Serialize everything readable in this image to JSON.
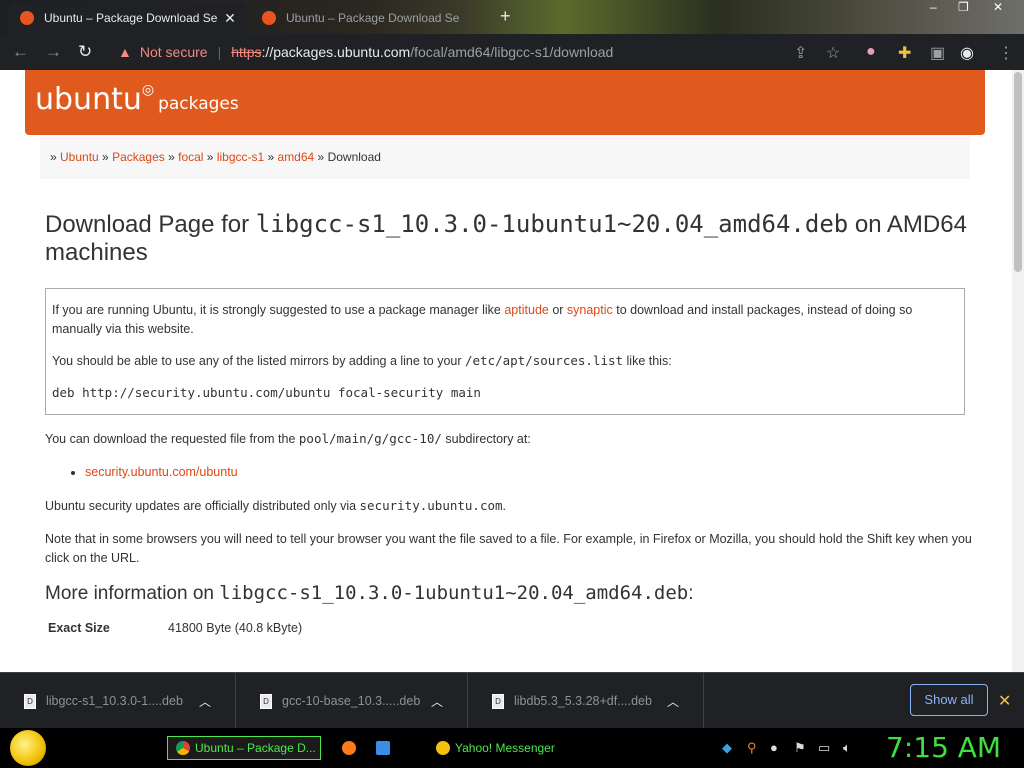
{
  "browser": {
    "tabs": [
      {
        "title": "Ubuntu – Package Download Se",
        "active": true
      },
      {
        "title": "Ubuntu – Package Download Se",
        "active": false
      }
    ],
    "new_tab_glyph": "+",
    "close_glyph": "✕",
    "nav": {
      "back": "←",
      "forward": "→",
      "reload": "↻"
    },
    "omnibox": {
      "warn_icon": "▲",
      "not_secure": "Not secure",
      "scheme": "https",
      "host": "://packages.ubuntu.com",
      "path": "/focal/amd64/libgcc-s1/download"
    },
    "toolbar_icons": [
      "share-icon",
      "star-icon",
      "profile-flag-icon",
      "extensions-icon",
      "sidepanel-icon",
      "account-icon",
      "menu-icon"
    ],
    "window_controls": {
      "minimize": "–",
      "maximize": "❐",
      "close": "✕"
    }
  },
  "page": {
    "logo": {
      "word": "ubuntu",
      "sub": "packages"
    },
    "breadcrumb": [
      {
        "label": "Ubuntu",
        "link": true
      },
      {
        "label": "Packages",
        "link": true
      },
      {
        "label": "focal",
        "link": true
      },
      {
        "label": "libgcc-s1",
        "link": true
      },
      {
        "label": "amd64",
        "link": true
      },
      {
        "label": "Download",
        "link": false
      }
    ],
    "heading": {
      "prefix": "Download Page for ",
      "file": "libgcc-s1_10.3.0-1ubuntu1~20.04_amd64.deb",
      "suffix": " on AMD64 machines"
    },
    "notice": {
      "p1_a": "If you are running Ubuntu, it is strongly suggested to use a package manager like ",
      "aptitude": "aptitude",
      "p1_or": " or ",
      "synaptic": "synaptic",
      "p1_b": " to download and install packages, instead of doing so manually via this website.",
      "p2_a": "You should be able to use any of the listed mirrors by adding a line to your ",
      "sources_path": "/etc/apt/sources.list",
      "p2_b": " like this:",
      "deb_line": "deb http://security.ubuntu.com/ubuntu focal-security main"
    },
    "download": {
      "p_a": "You can download the requested file from the ",
      "subdir": "pool/main/g/gcc-10/",
      "p_b": " subdirectory at:",
      "mirror": "security.ubuntu.com/ubuntu",
      "security_a": "Ubuntu security updates are officially distributed only via ",
      "security_host": "security.ubuntu.com",
      "security_b": ".",
      "note": "Note that in some browsers you will need to tell your browser you want the file saved to a file. For example, in Firefox or Mozilla, you should hold the Shift key when you click on the URL."
    },
    "more_info": {
      "prefix": "More information on ",
      "file": "libgcc-s1_10.3.0-1ubuntu1~20.04_amd64.deb",
      "suffix": ":",
      "exact_size_label": "Exact Size",
      "exact_size_value": "41800 Byte (40.8 kByte)"
    }
  },
  "downloads_shelf": {
    "items": [
      {
        "name": "libgcc-s1_10.3.0-1....deb"
      },
      {
        "name": "gcc-10-base_10.3.....deb"
      },
      {
        "name": "libdb5.3_5.3.28+df....deb"
      }
    ],
    "chevron": "︿",
    "show_all": "Show all",
    "close": "✕"
  },
  "taskbar": {
    "tasks": [
      {
        "label": "Ubuntu – Package D..."
      },
      {
        "label": "Yahoo! Messenger"
      }
    ],
    "clock": "7:15 AM"
  },
  "colors": {
    "ubuntu_orange": "#e05a1d",
    "link": "#dd4814",
    "taskbar_green": "#3de03d"
  }
}
